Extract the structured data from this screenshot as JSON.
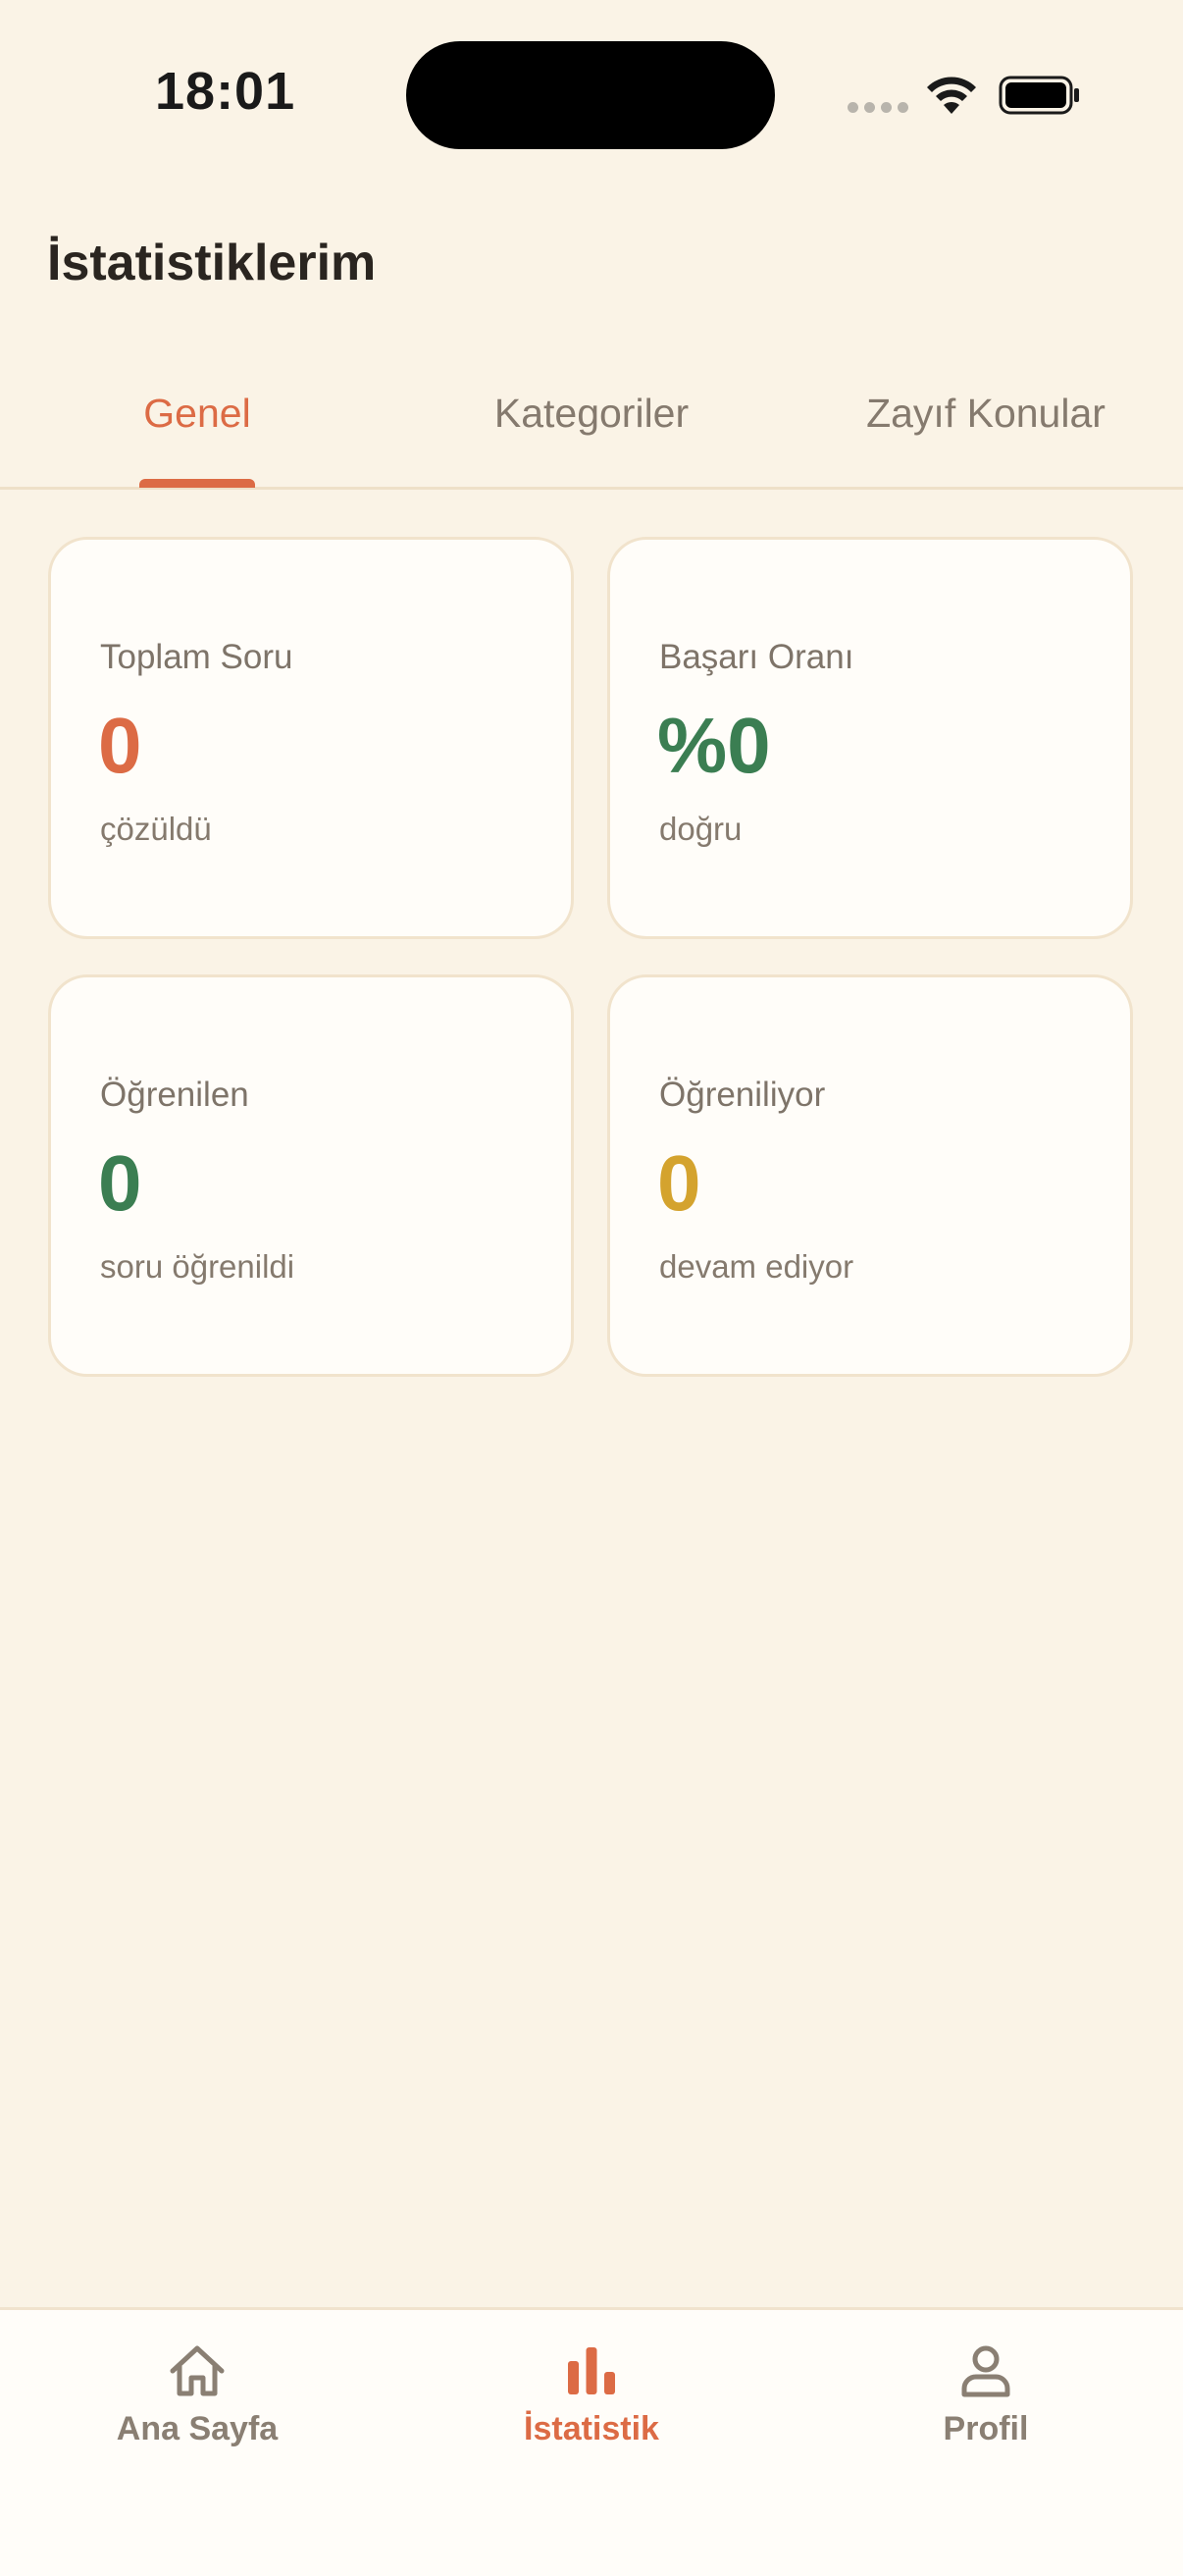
{
  "status_bar": {
    "time": "18:01"
  },
  "page": {
    "title": "İstatistiklerim"
  },
  "tabs": [
    {
      "label": "Genel",
      "active": true
    },
    {
      "label": "Kategoriler",
      "active": false
    },
    {
      "label": "Zayıf Konular",
      "active": false
    }
  ],
  "stats": [
    {
      "label": "Toplam Soru",
      "value": "0",
      "sub": "çözüldü",
      "color": "#DC6B45"
    },
    {
      "label": "Başarı Oranı",
      "value": "%0",
      "sub": "doğru",
      "color": "#3B7E52"
    },
    {
      "label": "Öğrenilen",
      "value": "0",
      "sub": "soru öğrenildi",
      "color": "#3B7E52"
    },
    {
      "label": "Öğreniliyor",
      "value": "0",
      "sub": "devam ediyor",
      "color": "#D4A32E"
    }
  ],
  "bottom_nav": [
    {
      "label": "Ana Sayfa",
      "icon": "home-icon",
      "active": false
    },
    {
      "label": "İstatistik",
      "icon": "bar-chart-icon",
      "active": true
    },
    {
      "label": "Profil",
      "icon": "user-icon",
      "active": false
    }
  ],
  "colors": {
    "background": "#FAF3E6",
    "accent": "#DC6B45",
    "success": "#3B7E52",
    "warning": "#D4A32E",
    "muted_text": "#857A6E"
  }
}
